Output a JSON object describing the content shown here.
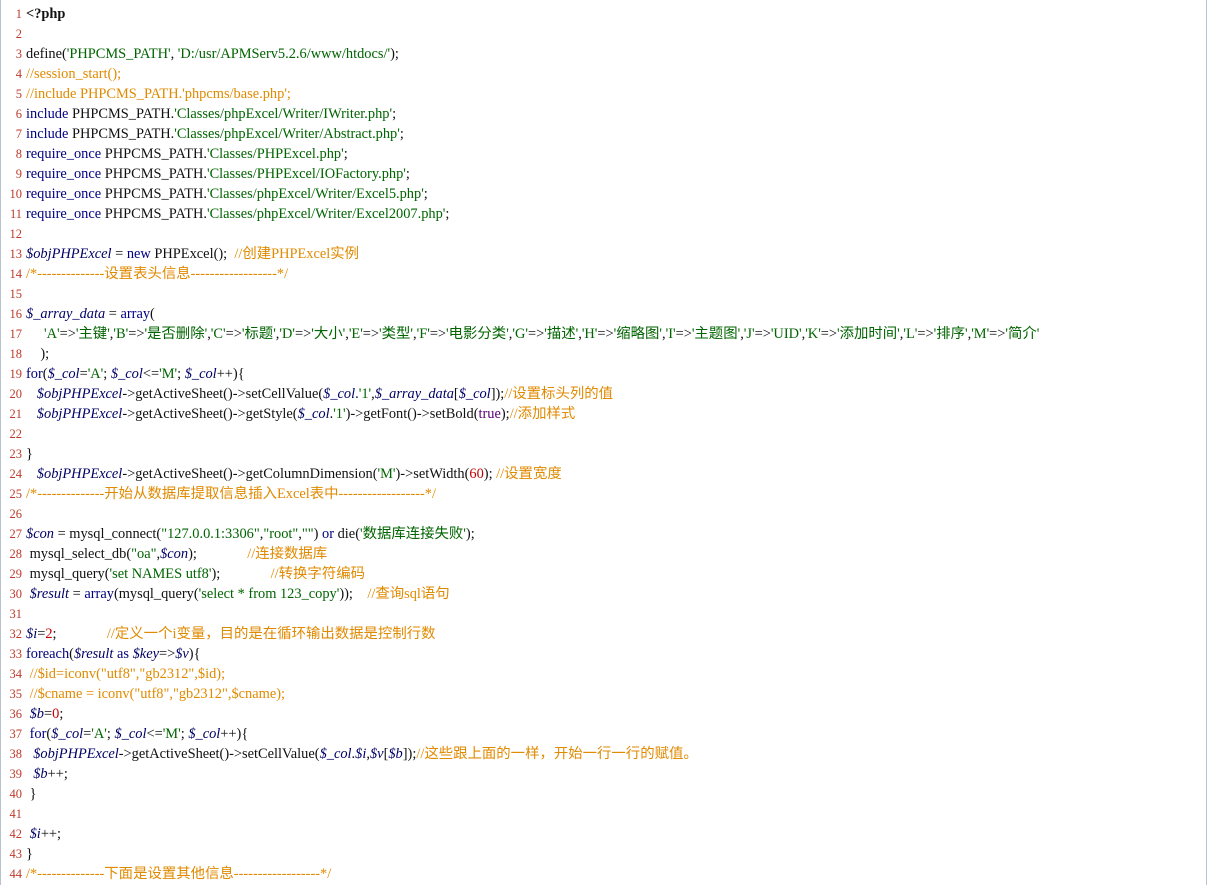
{
  "editor": {
    "lines": [
      {
        "n": "1",
        "tokens": [
          {
            "t": "<?php",
            "c": "php"
          }
        ]
      },
      {
        "n": "2",
        "tokens": []
      },
      {
        "n": "3",
        "tokens": [
          {
            "t": "define(",
            "c": ""
          },
          {
            "t": "'PHPCMS_PATH'",
            "c": "str"
          },
          {
            "t": ", ",
            "c": ""
          },
          {
            "t": "'D:/usr/APMServ5.2.6/www/htdocs/'",
            "c": "str"
          },
          {
            "t": ");",
            "c": ""
          }
        ]
      },
      {
        "n": "4",
        "tokens": [
          {
            "t": "//session_start();",
            "c": "cmt"
          }
        ]
      },
      {
        "n": "5",
        "tokens": [
          {
            "t": "//include PHPCMS_PATH.'phpcms/base.php';",
            "c": "cmt"
          }
        ]
      },
      {
        "n": "6",
        "tokens": [
          {
            "t": "include ",
            "c": "kw"
          },
          {
            "t": "PHPCMS_PATH.",
            "c": ""
          },
          {
            "t": "'Classes/phpExcel/Writer/IWriter.php'",
            "c": "str"
          },
          {
            "t": ";",
            "c": ""
          }
        ]
      },
      {
        "n": "7",
        "tokens": [
          {
            "t": "include ",
            "c": "kw"
          },
          {
            "t": "PHPCMS_PATH.",
            "c": ""
          },
          {
            "t": "'Classes/phpExcel/Writer/Abstract.php'",
            "c": "str"
          },
          {
            "t": ";",
            "c": ""
          }
        ]
      },
      {
        "n": "8",
        "tokens": [
          {
            "t": "require_once ",
            "c": "kw"
          },
          {
            "t": "PHPCMS_PATH.",
            "c": ""
          },
          {
            "t": "'Classes/PHPExcel.php'",
            "c": "str"
          },
          {
            "t": ";",
            "c": ""
          }
        ]
      },
      {
        "n": "9",
        "tokens": [
          {
            "t": "require_once ",
            "c": "kw"
          },
          {
            "t": "PHPCMS_PATH.",
            "c": ""
          },
          {
            "t": "'Classes/PHPExcel/IOFactory.php'",
            "c": "str"
          },
          {
            "t": ";",
            "c": ""
          }
        ]
      },
      {
        "n": "10",
        "tokens": [
          {
            "t": "require_once ",
            "c": "kw"
          },
          {
            "t": "PHPCMS_PATH.",
            "c": ""
          },
          {
            "t": "'Classes/phpExcel/Writer/Excel5.php'",
            "c": "str"
          },
          {
            "t": ";",
            "c": ""
          }
        ]
      },
      {
        "n": "11",
        "tokens": [
          {
            "t": "require_once ",
            "c": "kw"
          },
          {
            "t": "PHPCMS_PATH.",
            "c": ""
          },
          {
            "t": "'Classes/phpExcel/Writer/Excel2007.php'",
            "c": "str"
          },
          {
            "t": ";",
            "c": ""
          }
        ]
      },
      {
        "n": "12",
        "tokens": []
      },
      {
        "n": "13",
        "tokens": [
          {
            "t": "$objPHPExcel",
            "c": "var"
          },
          {
            "t": " = ",
            "c": ""
          },
          {
            "t": "new ",
            "c": "kw"
          },
          {
            "t": "PHPExcel();  ",
            "c": ""
          },
          {
            "t": "//创建PHPExcel实例",
            "c": "cmt"
          }
        ]
      },
      {
        "n": "14",
        "tokens": [
          {
            "t": "/*--------------设置表头信息------------------*/",
            "c": "cmt"
          }
        ]
      },
      {
        "n": "15",
        "tokens": []
      },
      {
        "n": "16",
        "tokens": [
          {
            "t": "$_array_data",
            "c": "var"
          },
          {
            "t": " = ",
            "c": ""
          },
          {
            "t": "array",
            "c": "kw"
          },
          {
            "t": "(",
            "c": ""
          }
        ]
      },
      {
        "n": "17",
        "tokens": [
          {
            "t": "     ",
            "c": ""
          },
          {
            "t": "'A'",
            "c": "str"
          },
          {
            "t": "=>",
            "c": ""
          },
          {
            "t": "'主键'",
            "c": "str"
          },
          {
            "t": ",",
            "c": ""
          },
          {
            "t": "'B'",
            "c": "str"
          },
          {
            "t": "=>",
            "c": ""
          },
          {
            "t": "'是否删除'",
            "c": "str"
          },
          {
            "t": ",",
            "c": ""
          },
          {
            "t": "'C'",
            "c": "str"
          },
          {
            "t": "=>",
            "c": ""
          },
          {
            "t": "'标题'",
            "c": "str"
          },
          {
            "t": ",",
            "c": ""
          },
          {
            "t": "'D'",
            "c": "str"
          },
          {
            "t": "=>",
            "c": ""
          },
          {
            "t": "'大小'",
            "c": "str"
          },
          {
            "t": ",",
            "c": ""
          },
          {
            "t": "'E'",
            "c": "str"
          },
          {
            "t": "=>",
            "c": ""
          },
          {
            "t": "'类型'",
            "c": "str"
          },
          {
            "t": ",",
            "c": ""
          },
          {
            "t": "'F'",
            "c": "str"
          },
          {
            "t": "=>",
            "c": ""
          },
          {
            "t": "'电影分类'",
            "c": "str"
          },
          {
            "t": ",",
            "c": ""
          },
          {
            "t": "'G'",
            "c": "str"
          },
          {
            "t": "=>",
            "c": ""
          },
          {
            "t": "'描述'",
            "c": "str"
          },
          {
            "t": ",",
            "c": ""
          },
          {
            "t": "'H'",
            "c": "str"
          },
          {
            "t": "=>",
            "c": ""
          },
          {
            "t": "'缩略图'",
            "c": "str"
          },
          {
            "t": ",",
            "c": ""
          },
          {
            "t": "'I'",
            "c": "str"
          },
          {
            "t": "=>",
            "c": ""
          },
          {
            "t": "'主题图'",
            "c": "str"
          },
          {
            "t": ",",
            "c": ""
          },
          {
            "t": "'J'",
            "c": "str"
          },
          {
            "t": "=>",
            "c": ""
          },
          {
            "t": "'UID'",
            "c": "str"
          },
          {
            "t": ",",
            "c": ""
          },
          {
            "t": "'K'",
            "c": "str"
          },
          {
            "t": "=>",
            "c": ""
          },
          {
            "t": "'添加时间'",
            "c": "str"
          },
          {
            "t": ",",
            "c": ""
          },
          {
            "t": "'L'",
            "c": "str"
          },
          {
            "t": "=>",
            "c": ""
          },
          {
            "t": "'排序'",
            "c": "str"
          },
          {
            "t": ",",
            "c": ""
          },
          {
            "t": "'M'",
            "c": "str"
          },
          {
            "t": "=>",
            "c": ""
          },
          {
            "t": "'简介'",
            "c": "str"
          }
        ]
      },
      {
        "n": "18",
        "tokens": [
          {
            "t": "    );",
            "c": ""
          }
        ]
      },
      {
        "n": "19",
        "tokens": [
          {
            "t": "for",
            "c": "kw"
          },
          {
            "t": "(",
            "c": ""
          },
          {
            "t": "$_col",
            "c": "var"
          },
          {
            "t": "=",
            "c": ""
          },
          {
            "t": "'A'",
            "c": "str"
          },
          {
            "t": "; ",
            "c": ""
          },
          {
            "t": "$_col",
            "c": "var"
          },
          {
            "t": "<=",
            "c": ""
          },
          {
            "t": "'M'",
            "c": "str"
          },
          {
            "t": "; ",
            "c": ""
          },
          {
            "t": "$_col",
            "c": "var"
          },
          {
            "t": "++){",
            "c": ""
          }
        ]
      },
      {
        "n": "20",
        "tokens": [
          {
            "t": "   ",
            "c": ""
          },
          {
            "t": "$objPHPExcel",
            "c": "var"
          },
          {
            "t": "->getActiveSheet()->setCellValue(",
            "c": ""
          },
          {
            "t": "$_col",
            "c": "var"
          },
          {
            "t": ".",
            "c": ""
          },
          {
            "t": "'1'",
            "c": "str"
          },
          {
            "t": ",",
            "c": ""
          },
          {
            "t": "$_array_data",
            "c": "var"
          },
          {
            "t": "[",
            "c": ""
          },
          {
            "t": "$_col",
            "c": "var"
          },
          {
            "t": "]);",
            "c": ""
          },
          {
            "t": "//设置标头列的值",
            "c": "cmt"
          }
        ]
      },
      {
        "n": "21",
        "tokens": [
          {
            "t": "   ",
            "c": ""
          },
          {
            "t": "$objPHPExcel",
            "c": "var"
          },
          {
            "t": "->getActiveSheet()->getStyle(",
            "c": ""
          },
          {
            "t": "$_col",
            "c": "var"
          },
          {
            "t": ".",
            "c": ""
          },
          {
            "t": "'1'",
            "c": "str"
          },
          {
            "t": ")->getFont()->setBold(",
            "c": ""
          },
          {
            "t": "true",
            "c": "lit"
          },
          {
            "t": ");",
            "c": ""
          },
          {
            "t": "//添加样式",
            "c": "cmt"
          }
        ]
      },
      {
        "n": "22",
        "tokens": []
      },
      {
        "n": "23",
        "tokens": [
          {
            "t": "}",
            "c": ""
          }
        ]
      },
      {
        "n": "24",
        "tokens": [
          {
            "t": "   ",
            "c": ""
          },
          {
            "t": "$objPHPExcel",
            "c": "var"
          },
          {
            "t": "->getActiveSheet()->getColumnDimension(",
            "c": ""
          },
          {
            "t": "'M'",
            "c": "str"
          },
          {
            "t": ")->setWidth(",
            "c": ""
          },
          {
            "t": "60",
            "c": "num"
          },
          {
            "t": "); ",
            "c": ""
          },
          {
            "t": "//设置宽度",
            "c": "cmt"
          }
        ]
      },
      {
        "n": "25",
        "tokens": [
          {
            "t": "/*--------------开始从数据库提取信息插入Excel表中------------------*/",
            "c": "cmt"
          }
        ]
      },
      {
        "n": "26",
        "tokens": []
      },
      {
        "n": "27",
        "tokens": [
          {
            "t": "$con",
            "c": "var"
          },
          {
            "t": " = mysql_connect(",
            "c": ""
          },
          {
            "t": "\"127.0.0.1:3306\"",
            "c": "str"
          },
          {
            "t": ",",
            "c": ""
          },
          {
            "t": "\"root\"",
            "c": "str"
          },
          {
            "t": ",",
            "c": ""
          },
          {
            "t": "\"\"",
            "c": "str"
          },
          {
            "t": ") ",
            "c": ""
          },
          {
            "t": "or ",
            "c": "kw"
          },
          {
            "t": "die(",
            "c": ""
          },
          {
            "t": "'数据库连接失败'",
            "c": "str"
          },
          {
            "t": ");",
            "c": ""
          }
        ]
      },
      {
        "n": "28",
        "tokens": [
          {
            "t": " mysql_select_db(",
            "c": ""
          },
          {
            "t": "\"oa\"",
            "c": "str"
          },
          {
            "t": ",",
            "c": ""
          },
          {
            "t": "$con",
            "c": "var"
          },
          {
            "t": ");              ",
            "c": ""
          },
          {
            "t": "//连接数据库",
            "c": "cmt"
          }
        ]
      },
      {
        "n": "29",
        "tokens": [
          {
            "t": " mysql_query(",
            "c": ""
          },
          {
            "t": "'set NAMES utf8'",
            "c": "str"
          },
          {
            "t": ");              ",
            "c": ""
          },
          {
            "t": "//转换字符编码",
            "c": "cmt"
          }
        ]
      },
      {
        "n": "30",
        "tokens": [
          {
            "t": " ",
            "c": ""
          },
          {
            "t": "$result",
            "c": "var"
          },
          {
            "t": " = ",
            "c": ""
          },
          {
            "t": "array",
            "c": "kw"
          },
          {
            "t": "(mysql_query(",
            "c": ""
          },
          {
            "t": "'select * from 123_copy'",
            "c": "str"
          },
          {
            "t": "));    ",
            "c": ""
          },
          {
            "t": "//查询sql语句",
            "c": "cmt"
          }
        ]
      },
      {
        "n": "31",
        "tokens": []
      },
      {
        "n": "32",
        "tokens": [
          {
            "t": "$i",
            "c": "var"
          },
          {
            "t": "=",
            "c": ""
          },
          {
            "t": "2",
            "c": "num"
          },
          {
            "t": ";              ",
            "c": ""
          },
          {
            "t": "//定义一个i变量，目的是在循环输出数据是控制行数",
            "c": "cmt"
          }
        ]
      },
      {
        "n": "33",
        "tokens": [
          {
            "t": "foreach",
            "c": "kw"
          },
          {
            "t": "(",
            "c": ""
          },
          {
            "t": "$result",
            "c": "var"
          },
          {
            "t": " ",
            "c": ""
          },
          {
            "t": "as",
            "c": "kw"
          },
          {
            "t": " ",
            "c": ""
          },
          {
            "t": "$key",
            "c": "var"
          },
          {
            "t": "=>",
            "c": ""
          },
          {
            "t": "$v",
            "c": "var"
          },
          {
            "t": "){",
            "c": ""
          }
        ]
      },
      {
        "n": "34",
        "tokens": [
          {
            "t": " //$id=iconv(\"utf8\",\"gb2312\",$id);",
            "c": "cmt"
          }
        ]
      },
      {
        "n": "35",
        "tokens": [
          {
            "t": " //$cname = iconv(\"utf8\",\"gb2312\",$cname);",
            "c": "cmt"
          }
        ]
      },
      {
        "n": "36",
        "tokens": [
          {
            "t": " ",
            "c": ""
          },
          {
            "t": "$b",
            "c": "var"
          },
          {
            "t": "=",
            "c": ""
          },
          {
            "t": "0",
            "c": "num"
          },
          {
            "t": ";",
            "c": ""
          }
        ]
      },
      {
        "n": "37",
        "tokens": [
          {
            "t": " for",
            "c": "kw"
          },
          {
            "t": "(",
            "c": ""
          },
          {
            "t": "$_col",
            "c": "var"
          },
          {
            "t": "=",
            "c": ""
          },
          {
            "t": "'A'",
            "c": "str"
          },
          {
            "t": "; ",
            "c": ""
          },
          {
            "t": "$_col",
            "c": "var"
          },
          {
            "t": "<=",
            "c": ""
          },
          {
            "t": "'M'",
            "c": "str"
          },
          {
            "t": "; ",
            "c": ""
          },
          {
            "t": "$_col",
            "c": "var"
          },
          {
            "t": "++){",
            "c": ""
          }
        ]
      },
      {
        "n": "38",
        "tokens": [
          {
            "t": "  ",
            "c": ""
          },
          {
            "t": "$objPHPExcel",
            "c": "var"
          },
          {
            "t": "->getActiveSheet()->setCellValue(",
            "c": ""
          },
          {
            "t": "$_col",
            "c": "var"
          },
          {
            "t": ".",
            "c": ""
          },
          {
            "t": "$i",
            "c": "var"
          },
          {
            "t": ",",
            "c": ""
          },
          {
            "t": "$v",
            "c": "var"
          },
          {
            "t": "[",
            "c": ""
          },
          {
            "t": "$b",
            "c": "var"
          },
          {
            "t": "]);",
            "c": ""
          },
          {
            "t": "//这些跟上面的一样，开始一行一行的赋值。",
            "c": "cmt"
          }
        ]
      },
      {
        "n": "39",
        "tokens": [
          {
            "t": "  ",
            "c": ""
          },
          {
            "t": "$b",
            "c": "var"
          },
          {
            "t": "++;",
            "c": ""
          }
        ]
      },
      {
        "n": "40",
        "tokens": [
          {
            "t": " }",
            "c": ""
          }
        ]
      },
      {
        "n": "41",
        "tokens": []
      },
      {
        "n": "42",
        "tokens": [
          {
            "t": " ",
            "c": ""
          },
          {
            "t": "$i",
            "c": "var"
          },
          {
            "t": "++;",
            "c": ""
          }
        ]
      },
      {
        "n": "43",
        "tokens": [
          {
            "t": "}",
            "c": ""
          }
        ]
      },
      {
        "n": "44",
        "tokens": [
          {
            "t": "/*--------------下面是设置其他信息------------------*/",
            "c": "cmt"
          }
        ]
      }
    ]
  }
}
